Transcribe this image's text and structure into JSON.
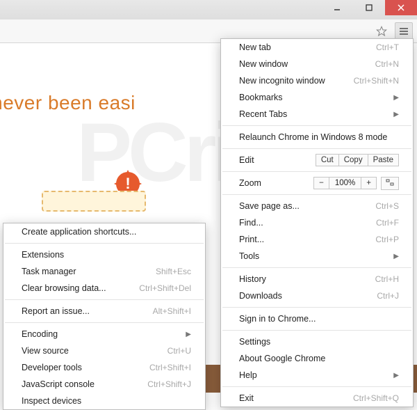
{
  "window": {
    "min": "minimize",
    "max": "maximize",
    "close": "close"
  },
  "page": {
    "headline": "ning has never been easi"
  },
  "menu": {
    "new_tab": {
      "label": "New tab",
      "shortcut": "Ctrl+T"
    },
    "new_window": {
      "label": "New window",
      "shortcut": "Ctrl+N"
    },
    "new_incognito": {
      "label": "New incognito window",
      "shortcut": "Ctrl+Shift+N"
    },
    "bookmarks": {
      "label": "Bookmarks"
    },
    "recent_tabs": {
      "label": "Recent Tabs"
    },
    "relaunch": {
      "label": "Relaunch Chrome in Windows 8 mode"
    },
    "edit": {
      "label": "Edit",
      "cut": "Cut",
      "copy": "Copy",
      "paste": "Paste"
    },
    "zoom": {
      "label": "Zoom",
      "minus": "−",
      "value": "100%",
      "plus": "+"
    },
    "save_as": {
      "label": "Save page as...",
      "shortcut": "Ctrl+S"
    },
    "find": {
      "label": "Find...",
      "shortcut": "Ctrl+F"
    },
    "print": {
      "label": "Print...",
      "shortcut": "Ctrl+P"
    },
    "tools": {
      "label": "Tools"
    },
    "history": {
      "label": "History",
      "shortcut": "Ctrl+H"
    },
    "downloads": {
      "label": "Downloads",
      "shortcut": "Ctrl+J"
    },
    "sign_in": {
      "label": "Sign in to Chrome..."
    },
    "settings": {
      "label": "Settings"
    },
    "about": {
      "label": "About Google Chrome"
    },
    "help": {
      "label": "Help"
    },
    "exit": {
      "label": "Exit",
      "shortcut": "Ctrl+Shift+Q"
    }
  },
  "tools_menu": {
    "create_shortcuts": {
      "label": "Create application shortcuts..."
    },
    "extensions": {
      "label": "Extensions"
    },
    "task_manager": {
      "label": "Task manager",
      "shortcut": "Shift+Esc"
    },
    "clear_data": {
      "label": "Clear browsing data...",
      "shortcut": "Ctrl+Shift+Del"
    },
    "report_issue": {
      "label": "Report an issue...",
      "shortcut": "Alt+Shift+I"
    },
    "encoding": {
      "label": "Encoding"
    },
    "view_source": {
      "label": "View source",
      "shortcut": "Ctrl+U"
    },
    "developer_tools": {
      "label": "Developer tools",
      "shortcut": "Ctrl+Shift+I"
    },
    "js_console": {
      "label": "JavaScript console",
      "shortcut": "Ctrl+Shift+J"
    },
    "inspect_devices": {
      "label": "Inspect devices"
    }
  }
}
